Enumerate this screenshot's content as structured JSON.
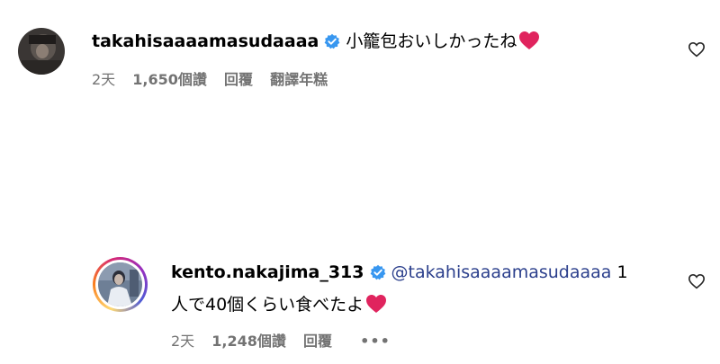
{
  "comments": [
    {
      "username": "takahisaaaamasudaaaa",
      "verified_icon": "verified-badge-icon",
      "text": "小籠包おいしかったね",
      "emoji": "red-heart-emoji",
      "time": "2天",
      "likes": "1,650個讚",
      "reply": "回覆",
      "translate": "翻譯年糕",
      "like_icon": "heart-outline-icon"
    },
    {
      "username": "kento.nakajima_313",
      "verified_icon": "verified-badge-icon",
      "mention": "@takahisaaaamasudaaaa",
      "text_line1_tail": " 1",
      "text_line2": "人で40個くらい食べたよ",
      "emoji": "red-heart-emoji",
      "time": "2天",
      "likes": "1,248個讚",
      "reply": "回覆",
      "more": "•••",
      "like_icon": "heart-outline-icon"
    }
  ],
  "colors": {
    "verified": "#3897f0",
    "heart_emoji": "#e0245e",
    "meta_text": "#737373",
    "mention": "#2b3f8c"
  }
}
